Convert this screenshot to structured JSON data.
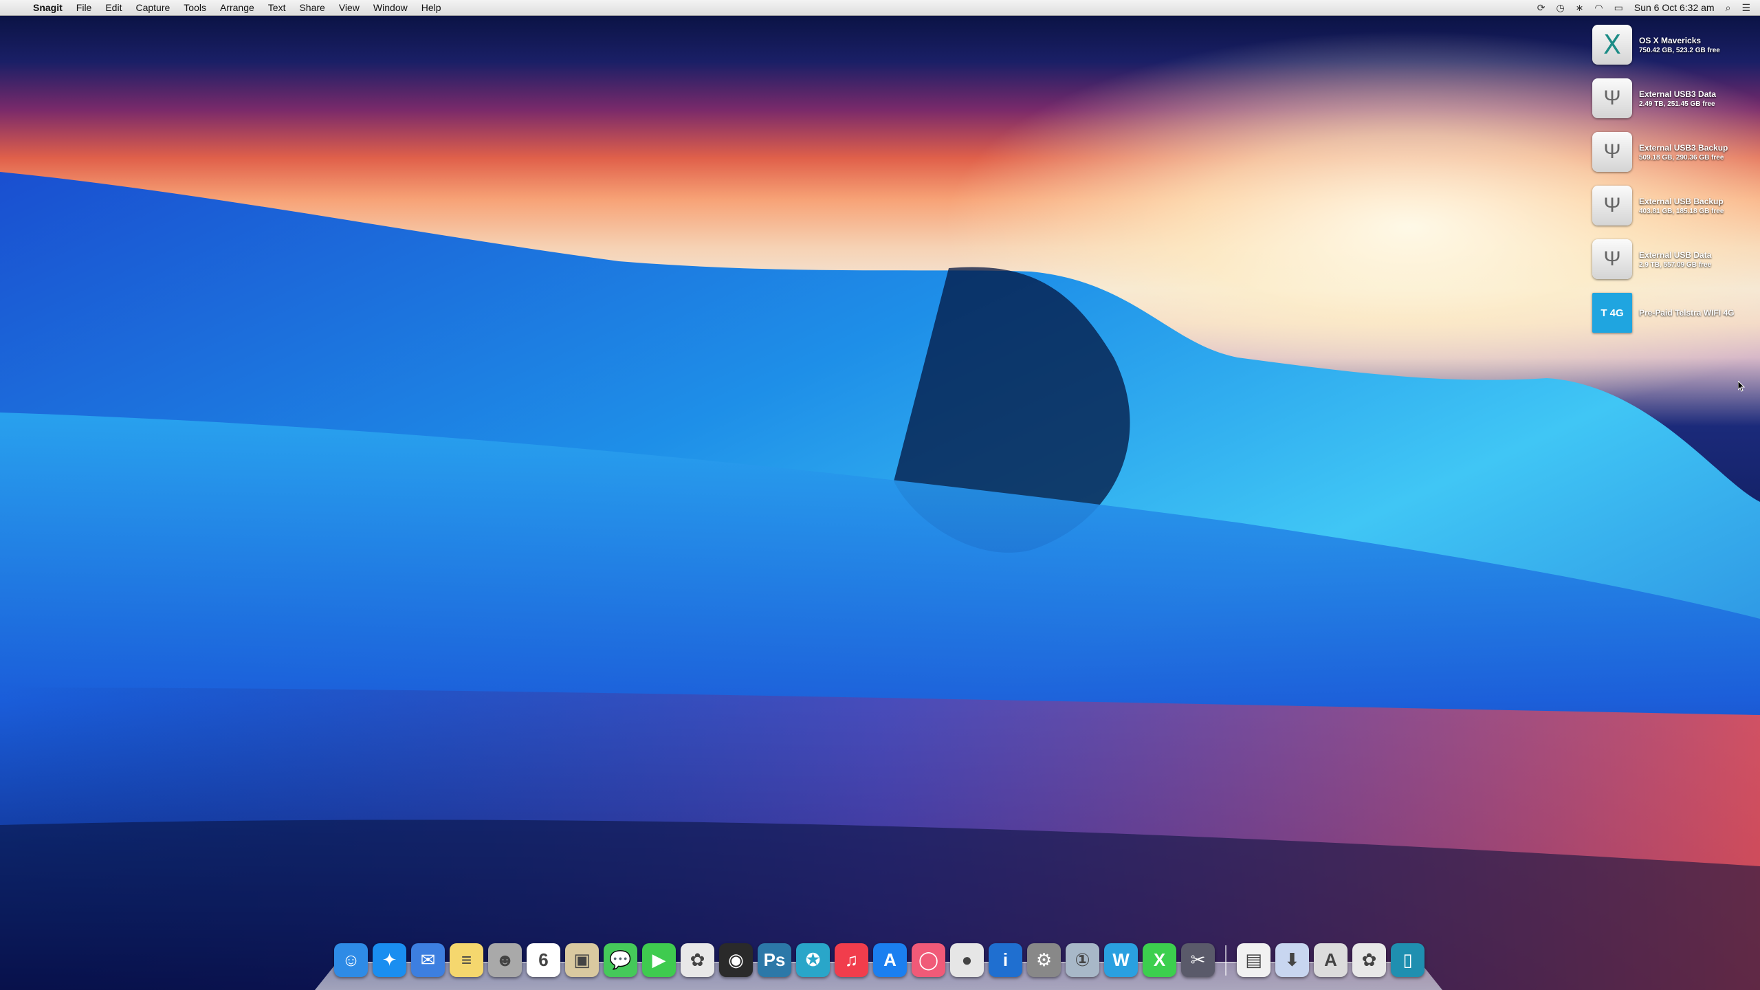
{
  "menubar": {
    "apple_icon": "apple-icon",
    "app_name": "Snagit",
    "menus": [
      "File",
      "Edit",
      "Capture",
      "Tools",
      "Arrange",
      "Text",
      "Share",
      "View",
      "Window",
      "Help"
    ],
    "clock": "Sun 6 Oct  6:32 am",
    "tray_icons": [
      "sync-icon",
      "time-machine-icon",
      "bluetooth-icon",
      "wifi-icon",
      "battery-icon",
      "spotlight-search-icon",
      "notification-center-icon"
    ]
  },
  "desktop_items": [
    {
      "name": "OS X Mavericks",
      "info": "750.42 GB, 523.2 GB free",
      "icon": "osx-drive-icon"
    },
    {
      "name": "External USB3 Data",
      "info": "2.49 TB, 251.45 GB free",
      "icon": "usb-drive-icon"
    },
    {
      "name": "External USB3 Backup",
      "info": "509.18 GB, 290.36 GB free",
      "icon": "usb-drive-icon"
    },
    {
      "name": "External USB Backup",
      "info": "403.81 GB, 185.18 GB free",
      "icon": "usb-drive-icon"
    },
    {
      "name": "External USB Data",
      "info": "2.9 TB, 557.09 GB free",
      "icon": "usb-drive-icon"
    },
    {
      "name": "Pre-Paid Telstra WIFI 4G",
      "info": "",
      "icon": "telstra-4g-icon"
    }
  ],
  "dock": {
    "apps": [
      {
        "name": "finder-icon",
        "glyph": "☺",
        "color": "#2e8be6"
      },
      {
        "name": "safari-icon",
        "glyph": "✦",
        "color": "#1a8ef0"
      },
      {
        "name": "mail-icon",
        "glyph": "✉",
        "color": "#3d7fe0"
      },
      {
        "name": "notes-icon",
        "glyph": "≡",
        "color": "#f5d76e"
      },
      {
        "name": "contacts-icon",
        "glyph": "☻",
        "color": "#a9a9a9"
      },
      {
        "name": "calendar-icon",
        "glyph": "6",
        "color": "#ffffff"
      },
      {
        "name": "preview-icon",
        "glyph": "▣",
        "color": "#d9c9a0"
      },
      {
        "name": "messages-icon",
        "glyph": "💬",
        "color": "#45c95a"
      },
      {
        "name": "facetime-icon",
        "glyph": "▶",
        "color": "#3fcb4f"
      },
      {
        "name": "photos-icon",
        "glyph": "✿",
        "color": "#e8e8e8"
      },
      {
        "name": "camera-icon",
        "glyph": "◉",
        "color": "#2a2a2a"
      },
      {
        "name": "photoshop-icon",
        "glyph": "Ps",
        "color": "#2c78a8"
      },
      {
        "name": "gear-app-icon",
        "glyph": "✪",
        "color": "#29a6c9"
      },
      {
        "name": "itunes-icon",
        "glyph": "♫",
        "color": "#f13d4c"
      },
      {
        "name": "app-store-icon",
        "glyph": "A",
        "color": "#1b7ff0"
      },
      {
        "name": "record-icon",
        "glyph": "◯",
        "color": "#f05a78"
      },
      {
        "name": "game-center-icon",
        "glyph": "●",
        "color": "#e6e6e6"
      },
      {
        "name": "info-icon",
        "glyph": "i",
        "color": "#1f6fd0"
      },
      {
        "name": "system-preferences-icon",
        "glyph": "⚙",
        "color": "#888888"
      },
      {
        "name": "onepassword-icon",
        "glyph": "①",
        "color": "#a8b8c8"
      },
      {
        "name": "word-icon",
        "glyph": "W",
        "color": "#2aa0e0"
      },
      {
        "name": "excel-icon",
        "glyph": "X",
        "color": "#3ccf4e"
      },
      {
        "name": "scissors-icon",
        "glyph": "✂",
        "color": "#5a5a6a"
      }
    ],
    "docs": [
      {
        "name": "documents-folder-icon",
        "glyph": "▤",
        "color": "#f1f1f1"
      },
      {
        "name": "downloads-folder-icon",
        "glyph": "⬇",
        "color": "#c8d6f0"
      },
      {
        "name": "applications-folder-icon",
        "glyph": "A",
        "color": "#dcdcdc"
      },
      {
        "name": "photos-stack-icon",
        "glyph": "✿",
        "color": "#e8e8e8"
      },
      {
        "name": "trash-icon",
        "glyph": "▯",
        "color": "#1f8fb0"
      }
    ]
  }
}
